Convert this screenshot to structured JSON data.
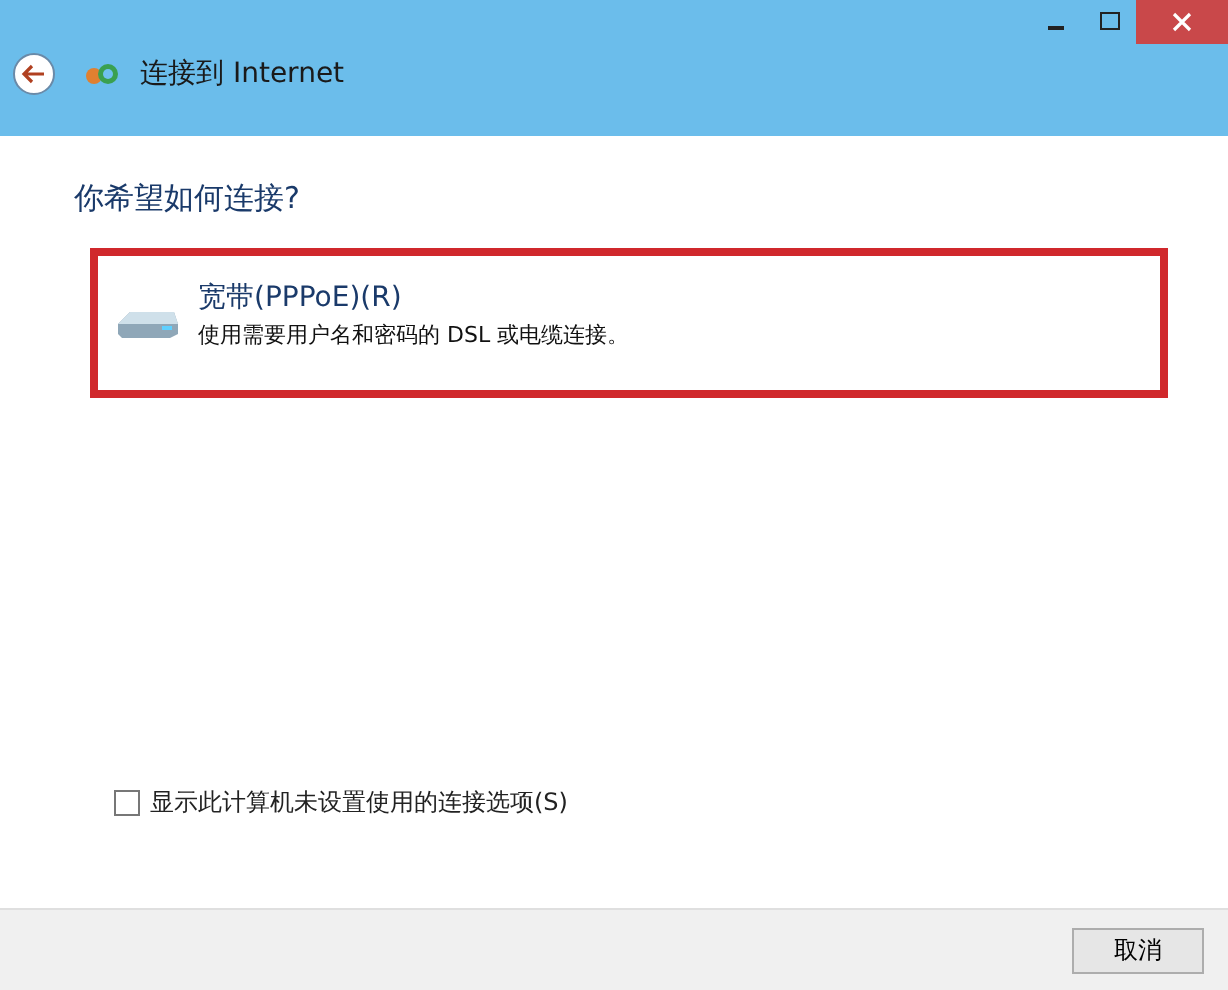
{
  "window": {
    "title": "连接到 Internet"
  },
  "heading": "你希望如何连接?",
  "options": [
    {
      "title": "宽带(PPPoE)(R)",
      "description": "使用需要用户名和密码的 DSL 或电缆连接。",
      "highlighted": true
    }
  ],
  "show_unconfigured": {
    "label": "显示此计算机未设置使用的连接选项(S)",
    "checked": false
  },
  "buttons": [
    "取消"
  ]
}
